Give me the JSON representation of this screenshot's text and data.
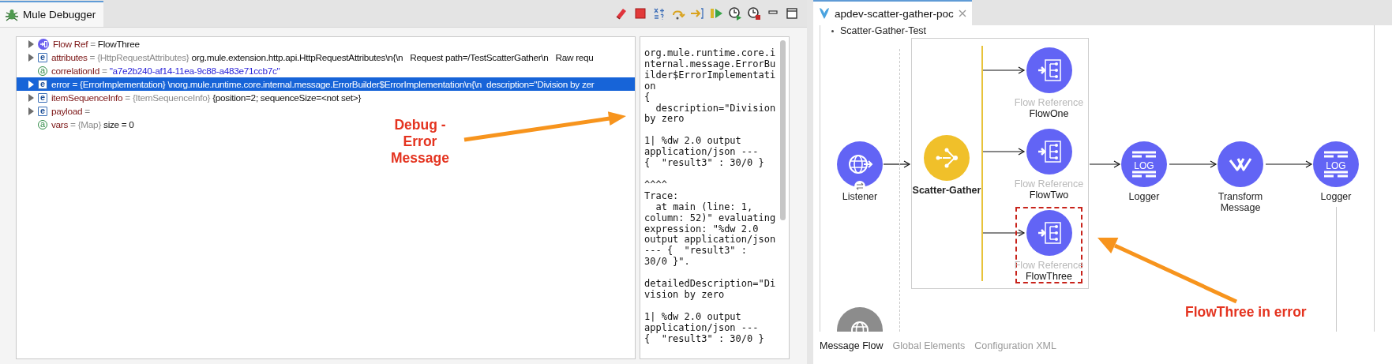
{
  "debugger": {
    "tab": {
      "label": "Mule Debugger",
      "selected": true
    },
    "variables": [
      {
        "kind": "flow-ref",
        "name": "Flow Ref",
        "separator": "=",
        "value": "FlowThree",
        "has_children": true,
        "selected": false
      },
      {
        "kind": "element",
        "badge": "e",
        "name": "attributes",
        "separator": "=",
        "type": "{HttpRequestAttributes}",
        "value": "org.mule.extension.http.api.HttpRequestAttributes\\n{\\n   Request path=/TestScatterGather\\n   Raw requ",
        "has_children": true,
        "selected": false
      },
      {
        "kind": "attribute",
        "badge": "a",
        "name": "correlationId",
        "separator": "=",
        "value": "\"a7e2b240-af14-11ea-9c88-a483e71ccb7c\"",
        "is_string": true,
        "has_children": false,
        "selected": false
      },
      {
        "kind": "element",
        "badge": "e",
        "name": "error",
        "separator": "=",
        "type": "{ErrorImplementation}",
        "value": "\\norg.mule.runtime.core.internal.message.ErrorBuilder$ErrorImplementation\\n{\\n  description=\"Division by zer",
        "has_children": true,
        "selected": true
      },
      {
        "kind": "element",
        "badge": "e",
        "name": "itemSequenceInfo",
        "separator": "=",
        "type": "{ItemSequenceInfo}",
        "value": "{position=2; sequenceSize=<not set>}",
        "has_children": true,
        "selected": false
      },
      {
        "kind": "element",
        "badge": "e",
        "name": "payload",
        "separator": "=",
        "has_children": true,
        "selected": false
      },
      {
        "kind": "attribute",
        "badge": "a",
        "name": "vars",
        "separator": "=",
        "type": "{Map}",
        "value": "size = 0",
        "has_children": false,
        "selected": false
      }
    ],
    "detail_text": "org.mule.runtime.core.internal.message.ErrorBuilder$ErrorImplementation\n{\n  description=\"Division by zero\n\n1| %dw 2.0 output application/json ---\n{  \"result3\" : 30/0 }\n\n^^^^\nTrace:\n  at main (line: 1, column: 52)\" evaluating expression: \"%dw 2.0 output application/json --- {  \"result3\" :\n30/0 }\".\n\ndetailedDescription=\"Division by zero\n\n1| %dw 2.0 output application/json ---\n{  \"result3\" : 30/0 }",
    "annotation": "Debug - Error Message"
  },
  "editor": {
    "tab": {
      "label": "apdev-scatter-gather-poc",
      "selected": true
    },
    "breadcrumb": "Scatter-Gather-Test",
    "source": {
      "kind": "listener",
      "label": "Listener"
    },
    "scatter_gather": {
      "label": "Scatter-Gather",
      "routes": [
        {
          "kind": "flow-ref",
          "type_label": "Flow Reference",
          "name": "FlowOne",
          "error": false
        },
        {
          "kind": "flow-ref",
          "type_label": "Flow Reference",
          "name": "FlowTwo",
          "error": false
        },
        {
          "kind": "flow-ref",
          "type_label": "Flow Reference",
          "name": "FlowThree",
          "error": true
        }
      ]
    },
    "processors": [
      {
        "kind": "logger",
        "label": "Logger",
        "icon_label": "LOG"
      },
      {
        "kind": "transform",
        "label": "Transform Message"
      },
      {
        "kind": "logger",
        "label": "Logger",
        "icon_label": "LOG"
      }
    ],
    "annotation": "FlowThree in error",
    "view_tabs": [
      {
        "label": "Message Flow",
        "selected": true
      },
      {
        "label": "Global Elements",
        "selected": false
      },
      {
        "label": "Configuration XML",
        "selected": false
      }
    ]
  }
}
